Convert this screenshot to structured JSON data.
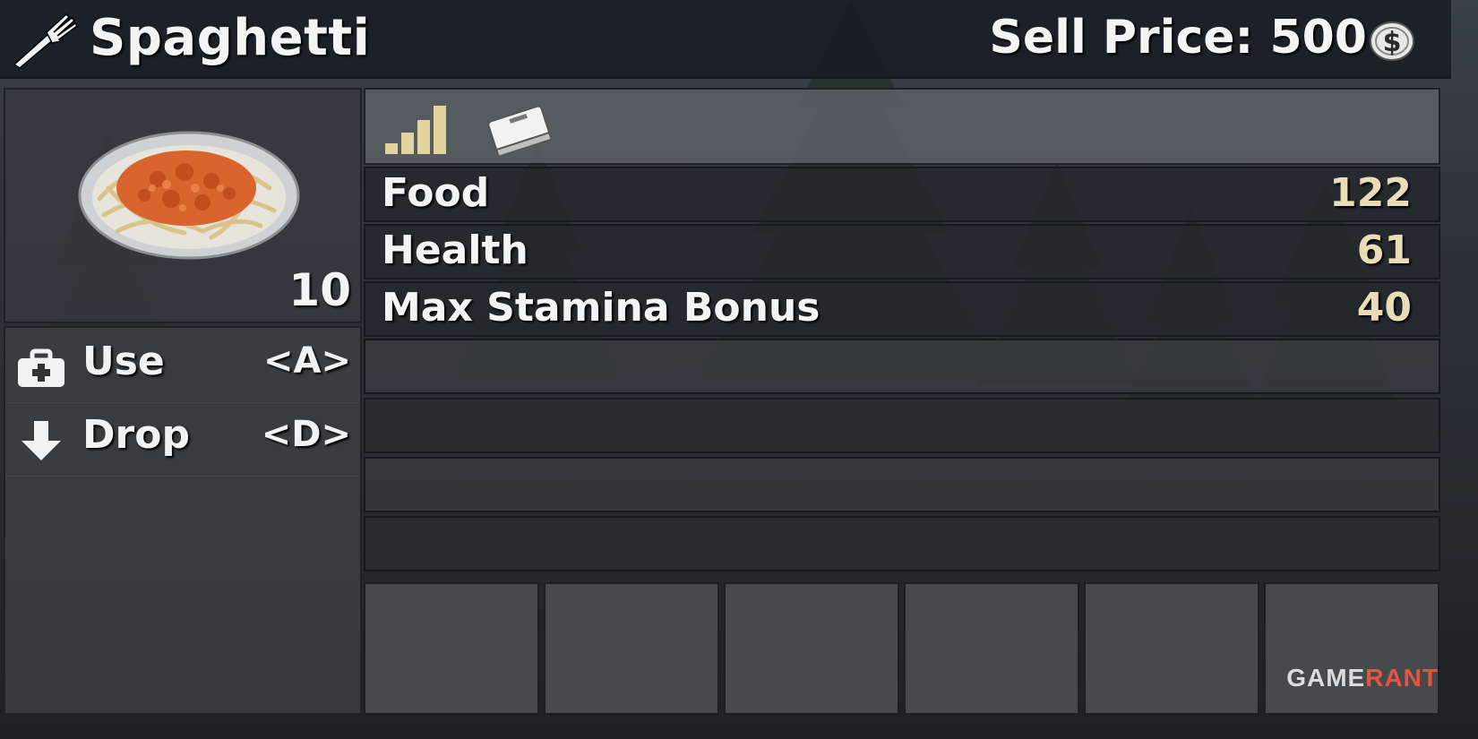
{
  "item": {
    "name": "Spaghetti",
    "sell_price_label": "Sell Price: 500",
    "stack_count": "10"
  },
  "actions": [
    {
      "label": "Use",
      "key": "<A>",
      "icon": "first-aid-kit-icon"
    },
    {
      "label": "Drop",
      "key": "<D>",
      "icon": "arrow-down-icon"
    }
  ],
  "tabs": [
    {
      "icon": "signal-bars-icon"
    },
    {
      "icon": "book-icon"
    }
  ],
  "stats": [
    {
      "name": "Food",
      "value": "122"
    },
    {
      "name": "Health",
      "value": "61"
    },
    {
      "name": "Max Stamina Bonus",
      "value": "40"
    }
  ],
  "watermark": {
    "part1": "GAME",
    "part2": "RANT"
  },
  "colors": {
    "stat_value": "#e9dcb6",
    "icon_gold": "#e3d3a0",
    "text": "#f4f4f4"
  }
}
